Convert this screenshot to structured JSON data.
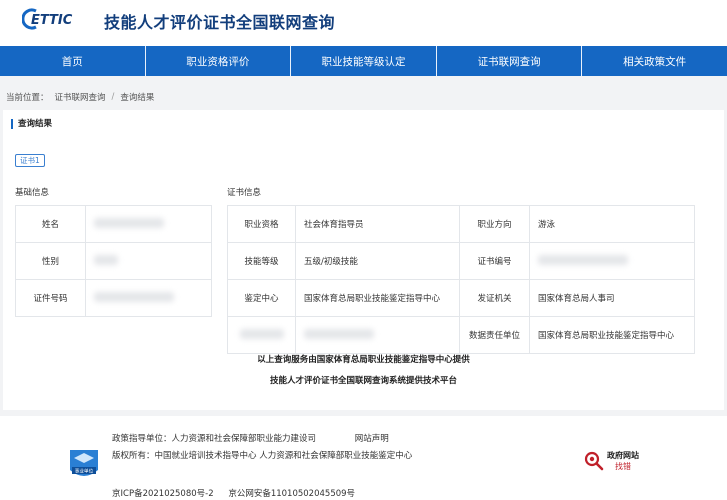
{
  "header": {
    "logo_text": "ETTIC",
    "site_title": "技能人才评价证书全国联网查询"
  },
  "nav": [
    "首页",
    "职业资格评价",
    "职业技能等级认定",
    "证书联网查询",
    "相关政策文件"
  ],
  "breadcrumb": {
    "prefix": "当前位置：",
    "items": [
      "证书联网查询",
      "查询结果"
    ],
    "separator": "/"
  },
  "result": {
    "section_title": "查询结果",
    "cert_tab": "证书1",
    "basic_title": "基础信息",
    "cert_title": "证书信息",
    "basic_labels": [
      "姓名",
      "性别",
      "证件号码"
    ],
    "cert_rows": [
      {
        "l1": "职业资格",
        "v1": "社会体育指导员",
        "l2": "职业方向",
        "v2": "游泳"
      },
      {
        "l1": "技能等级",
        "v1": "五级/初级技能",
        "l2": "证书编号",
        "v2": ""
      },
      {
        "l1": "鉴定中心",
        "v1": "国家体育总局职业技能鉴定指导中心",
        "l2": "发证机关",
        "v2": "国家体育总局人事司"
      },
      {
        "l1": "",
        "v1": "",
        "l2": "数据责任单位",
        "v2": "国家体育总局职业技能鉴定指导中心"
      }
    ],
    "notice_1": "以上查询服务由国家体育总局职业技能鉴定指导中心提供",
    "notice_2": "技能人才评价证书全国联网查询系统提供技术平台"
  },
  "footer": {
    "guide": "政策指导单位：人力资源和社会保障部职业能力建设司",
    "statement": "网站声明",
    "copyright": "版权所有：中国就业培训技术指导中心  人力资源和社会保障部职业技能鉴定中心",
    "icp": "京ICP备2021025080号-2",
    "police": "京公网安备11010502045509号",
    "emblem_label": "事业单位",
    "gov_title": "政府网站",
    "gov_sub": "找错"
  },
  "colors": {
    "nav_bg": "#1567c3",
    "title": "#123e7c",
    "accent": "#3a7fd0",
    "gov_red": "#c0202a"
  }
}
